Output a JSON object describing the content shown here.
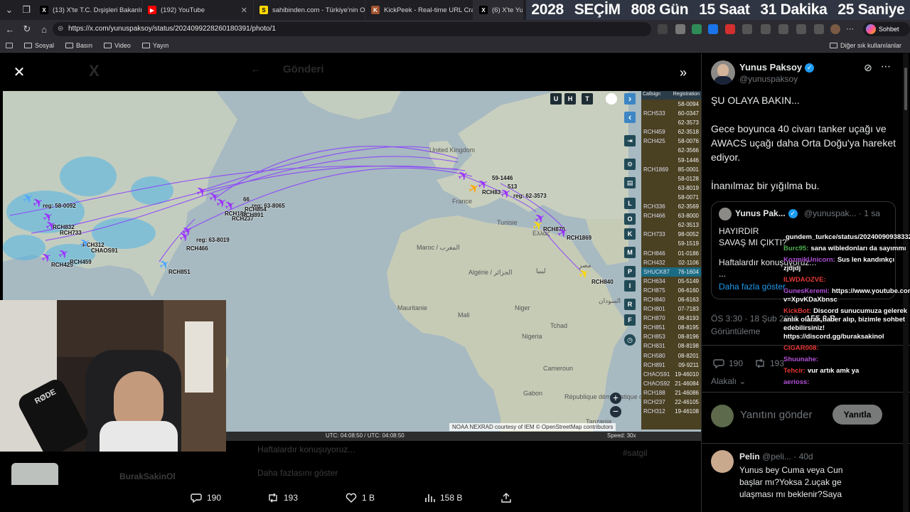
{
  "browser": {
    "tabs": [
      {
        "label": "(13) X'te T.C. Dışişleri Bakanlığı: \"...",
        "favicon": "x-icon"
      },
      {
        "label": "(192) YouTube",
        "favicon": "youtube-icon"
      },
      {
        "label": "sahibinden.com - Türkiye'nin Onl...",
        "favicon": "sahibinden-icon"
      },
      {
        "label": "KickPeek - Real-time URL Crawler...",
        "favicon": "kickpeek-icon"
      },
      {
        "label": "(6) X'te Yunus",
        "favicon": "x-icon"
      }
    ],
    "url": "https://x.com/yunuspaksoy/status/2024099228260180391/photo/1",
    "chat_button": "Sohbet et",
    "bookmarks": [
      "Sosyal",
      "Basın",
      "Video",
      "Yayın"
    ],
    "other_bookmarks": "Diğer sık kullanılanlar"
  },
  "countdown": {
    "year": "2028",
    "label": "SEÇİM",
    "days": "808 Gün",
    "hours": "15 Saat",
    "minutes": "31 Dakika",
    "seconds": "25 Saniye"
  },
  "background_header": {
    "title": "Gönderi",
    "name": "BurakSakinOl"
  },
  "map": {
    "attribution": "NOAA NEXRAD courtesy of IEM © OpenStreetMap contributors",
    "time": "UTC: 04:08:50 / UTC: 04:08:50",
    "speed": "Speed: 30x",
    "top_buttons": [
      "U",
      "H",
      "T"
    ],
    "side_buttons": [
      "L",
      "O",
      "K",
      "M",
      "P",
      "I",
      "R",
      "F"
    ],
    "list_headers": [
      "Callsign",
      "Registration"
    ],
    "list_rows": [
      {
        "cs": "",
        "reg": "58-0094"
      },
      {
        "cs": "RCH533",
        "reg": "60-0347"
      },
      {
        "cs": "",
        "reg": "62-3573"
      },
      {
        "cs": "RCH459",
        "reg": "62-3518"
      },
      {
        "cs": "RCH425",
        "reg": "58-0076"
      },
      {
        "cs": "",
        "reg": "62-3566"
      },
      {
        "cs": "",
        "reg": "59-1446"
      },
      {
        "cs": "RCH1869",
        "reg": "85-0001"
      },
      {
        "cs": "",
        "reg": "58-0128"
      },
      {
        "cs": "",
        "reg": "63-8019"
      },
      {
        "cs": "",
        "reg": "58-0071"
      },
      {
        "cs": "RCH336",
        "reg": "62-3569"
      },
      {
        "cs": "RCH466",
        "reg": "63-8000"
      },
      {
        "cs": "",
        "reg": "62-3513"
      },
      {
        "cs": "RCH733",
        "reg": "98-0052"
      },
      {
        "cs": "",
        "reg": "59-1519"
      },
      {
        "cs": "RCH846",
        "reg": "01-0186"
      },
      {
        "cs": "RCH432",
        "reg": "02-1106"
      },
      {
        "cs": "SHUCK87",
        "reg": "76-1604"
      },
      {
        "cs": "RCH634",
        "reg": "05-5149"
      },
      {
        "cs": "RCH875",
        "reg": "06-6160"
      },
      {
        "cs": "RCH840",
        "reg": "06-6163"
      },
      {
        "cs": "RCH801",
        "reg": "07-7183"
      },
      {
        "cs": "RCH870",
        "reg": "08-8193"
      },
      {
        "cs": "RCH851",
        "reg": "08-8195"
      },
      {
        "cs": "RCH853",
        "reg": "08-8196"
      },
      {
        "cs": "RCH831",
        "reg": "08-8198"
      },
      {
        "cs": "RCH580",
        "reg": "08-8201"
      },
      {
        "cs": "RCH891",
        "reg": "09-9211"
      },
      {
        "cs": "CHAOS91",
        "reg": "19-46010"
      },
      {
        "cs": "CHAOS92",
        "reg": "21-46084"
      },
      {
        "cs": "RCH188",
        "reg": "21-46086"
      },
      {
        "cs": "RCH237",
        "reg": "22-46105"
      },
      {
        "cs": "RCH312",
        "reg": "19-46108"
      }
    ],
    "place_labels": [
      "United Kingdom",
      "France",
      "Maroc / المغرب",
      "Mauritanie",
      "Mali",
      "Niger",
      "Algérie / الجزائر",
      "ليبيا",
      "مصر",
      "Tchad",
      "Nigeria",
      "Ελλάς",
      "Cameroun",
      "Gabon",
      "République démocratique du Congo",
      "Tanzania",
      "السودان",
      "Tunisie"
    ],
    "aircraft_labels": [
      "reg: 58-0092",
      "RCH832",
      "RCH733",
      "RCH312",
      "CHAOS91",
      "RCH425",
      "RCH459",
      "RCH851",
      "reg: 63-8019",
      "RCH466",
      "RCH188",
      "RCH237",
      "66",
      "reg: 63-8065",
      "RCH854",
      "RCH891",
      "59-1446",
      "RCH83",
      "reg: 62-3573",
      "513",
      "RCH870",
      "RCH1869",
      "RCH840"
    ]
  },
  "actions": {
    "reply": "190",
    "retweet": "193",
    "like": "1 B",
    "views": "158 B"
  },
  "background_text": {
    "quote_tail": "Haftalardır konuşuyoruz...",
    "handle_tail": "Daha fazlasını göster",
    "trend": "#satgil"
  },
  "post": {
    "author": "Yunus Paksoy",
    "handle": "@yunuspaksoy",
    "lines": [
      "ŞU OLAYA BAKIN...",
      "Gece boyunca 40 civarı tanker uçağı ve AWACS uçağı daha Orta Doğu'ya hareket ediyor.",
      "İnanılmaz bir yığılma bu."
    ],
    "quote": {
      "author": "Yunus Pak...",
      "handle": "@yunuspak...",
      "time": "· 1 sa",
      "line1": "HAYIRDIR",
      "line2": "SAVAŞ MI ÇIKTI?",
      "line3": "Haftalardır konuşuyoruz...",
      "line4": "...",
      "more": "Daha fazla göster"
    },
    "timestamp": "ÖS 3:30 · 18 Şub 2026 ·",
    "views": "155,3 B",
    "views_label": "Görüntüleme",
    "reply_count": "190",
    "retweet_count": "193",
    "like_count": "1 B",
    "alakali": "Alakalı",
    "reply_placeholder": "Yanıtını gönder",
    "reply_button": "Yanıtla"
  },
  "reply_post": {
    "author": "Pelin",
    "handle": "@peli...",
    "time": "· 40d",
    "text1": "Yunus bey Cuma veya Cun",
    "text2": "başlar mı?Yoksa 2.uçak ge",
    "text3": "ulaşması mı beklenir?Saya"
  },
  "chat": [
    {
      "user": "",
      "msg": "gundem_turkce/status/2024009093833277460",
      "color": "#ffffff"
    },
    {
      "user": "Burc95:",
      "msg": "sana wibledonları da sayımmı",
      "color": "#4caf50"
    },
    {
      "user": "KozmikUnicorn:",
      "msg": "Sus len kandınkçı zjdjdj",
      "color": "#b04fd6"
    },
    {
      "user": "ILWDAOZVE:",
      "msg": "",
      "color": "#e53935"
    },
    {
      "user": "GunesKeremi:",
      "msg": "https://www.youtube.com/watch?v=XpvKDaXbnsc",
      "color": "#b04fd6"
    },
    {
      "user": "KickBot:",
      "msg": "Discord sunucumuza gelerek anlık olarak haber alıp, bizimle sohbet edebilirsiniz! https://discord.gg/buraksakinol",
      "color": "#e53935"
    },
    {
      "user": "CIGAR008:",
      "msg": "",
      "color": "#e53935"
    },
    {
      "user": "Shuunahe:",
      "msg": "",
      "color": "#b04fd6"
    },
    {
      "user": "Tehcir:",
      "msg": "vur artık amk ya",
      "color": "#e53935"
    },
    {
      "user": "aerioss:",
      "msg": "",
      "color": "#b04fd6"
    }
  ],
  "colors": {
    "accent": "#1d9bf0",
    "aircraft": "#9b30ff",
    "track": "#8a3cff"
  }
}
